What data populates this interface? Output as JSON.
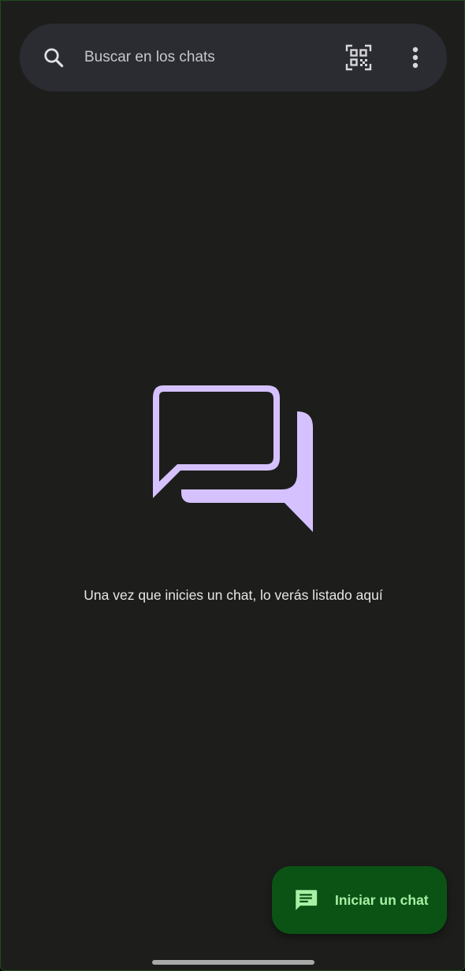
{
  "search": {
    "placeholder": "Buscar en los chats",
    "search_icon": "search-icon",
    "qr_icon": "qr-code-scanner-icon",
    "menu_icon": "more-vert-icon"
  },
  "empty_state": {
    "icon": "chat-bubbles-icon",
    "message": "Una vez que inicies un chat, lo verás listado aquí"
  },
  "fab": {
    "label": "Iniciar un chat",
    "icon": "message-icon"
  },
  "colors": {
    "background": "#1d1e1c",
    "search_bar": "#2b2c31",
    "illustration": "#d6c1ff",
    "fab_background": "#0b5315",
    "fab_text": "#a8f0a3",
    "nav_handle": "#a9a9a9"
  }
}
